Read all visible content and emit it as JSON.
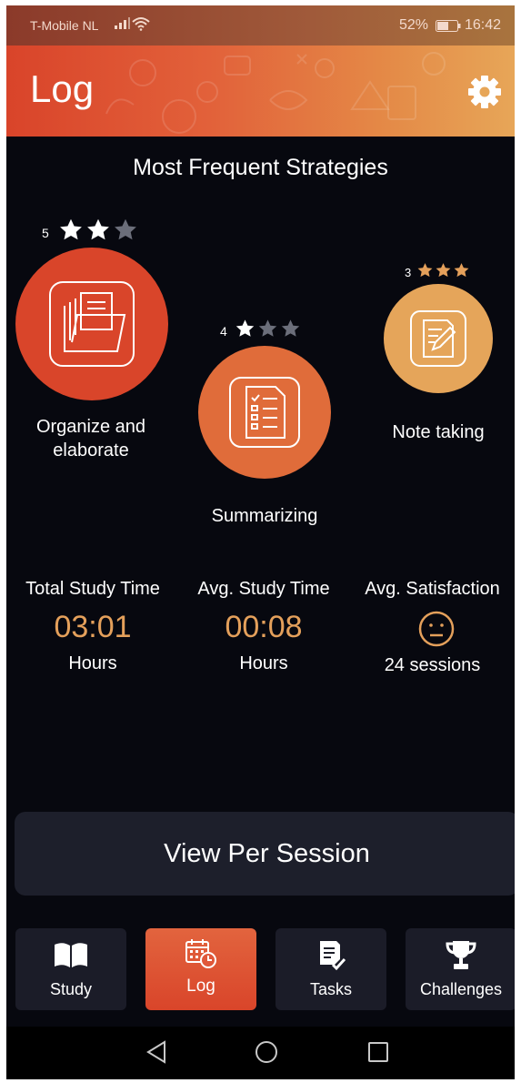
{
  "status_bar": {
    "carrier": "T-Mobile NL",
    "battery_percent": "52%",
    "time": "16:42"
  },
  "header": {
    "title": "Log",
    "settings_icon": "gear-icon"
  },
  "strategies": {
    "title": "Most Frequent Strategies",
    "items": [
      {
        "rank": "5",
        "stars": 2,
        "label": "Organize and elaborate",
        "icon": "folder-icon",
        "color": "#d9452a"
      },
      {
        "rank": "4",
        "stars": 1,
        "label": "Summarizing",
        "icon": "checklist-icon",
        "color": "#e06c3a"
      },
      {
        "rank": "3",
        "stars": 3,
        "label": "Note taking",
        "icon": "note-pencil-icon",
        "color": "#e5a55a"
      }
    ],
    "star_colors": {
      "filled_white": "#ffffff",
      "empty": "#6b6e7a",
      "gold": "#e4a05b"
    }
  },
  "stats": {
    "total": {
      "label": "Total Study Time",
      "value": "03:01",
      "unit": "Hours"
    },
    "average": {
      "label": "Avg. Study Time",
      "value": "00:08",
      "unit": "Hours"
    },
    "satisfaction": {
      "label": "Avg. Satisfaction",
      "icon": "neutral-face-icon",
      "unit": "24 sessions"
    }
  },
  "view_button": {
    "label": "View Per Session"
  },
  "tabs": [
    {
      "label": "Study",
      "icon": "book-icon",
      "active": false
    },
    {
      "label": "Log",
      "icon": "calendar-clock-icon",
      "active": true
    },
    {
      "label": "Tasks",
      "icon": "task-list-icon",
      "active": false
    },
    {
      "label": "Challenges",
      "icon": "trophy-icon",
      "active": false
    }
  ],
  "accent_color": "#e4a05b"
}
